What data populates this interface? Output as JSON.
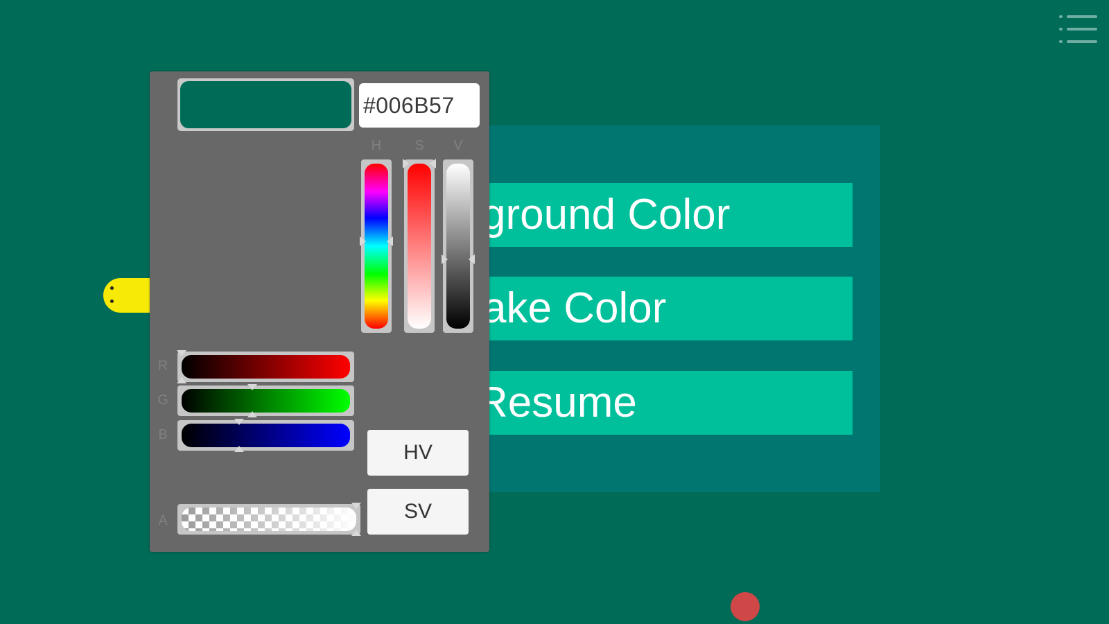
{
  "menu": {
    "icon": "hamburger-menu-icon"
  },
  "pause_menu": {
    "buttons": [
      {
        "label": "Background Color",
        "visible_text": "ground Color"
      },
      {
        "label": "Snake Color",
        "visible_text": "ake Color"
      },
      {
        "label": "Resume",
        "visible_text": "Resume"
      }
    ]
  },
  "color_picker": {
    "hex_value": "#006B57",
    "swatch_color": "#006B57",
    "hsv_labels": {
      "h": "H",
      "s": "S",
      "v": "V"
    },
    "hsv_levels": {
      "h": 0.47,
      "s": 0.0,
      "v": 0.58
    },
    "rgb_labels": {
      "r": "R",
      "g": "G",
      "b": "B"
    },
    "rgb_levels": {
      "r": 0.0,
      "g": 0.42,
      "b": 0.34
    },
    "alpha_label": "A",
    "alpha_level": 1.0,
    "mode_buttons": {
      "hv": "HV",
      "sv": "SV"
    }
  },
  "game": {
    "background_color": "#006B57",
    "snake_color": "#F7EA06",
    "food_color": "#CF4747"
  }
}
